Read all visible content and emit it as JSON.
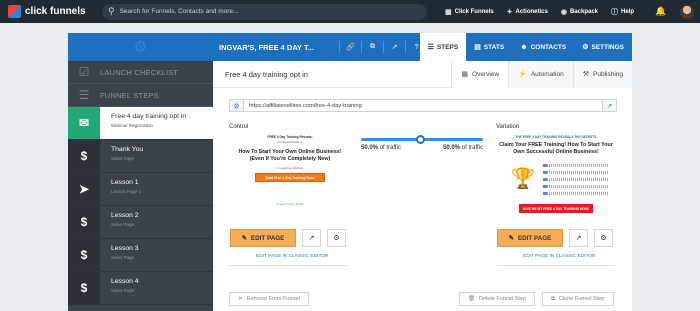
{
  "topbar": {
    "logo_text": "click funnels",
    "search_placeholder": "Search for Funnels, Contacts and more...",
    "nav": [
      {
        "label": "Click Funnels",
        "icon": "clickfunnels-icon"
      },
      {
        "label": "Actionetics",
        "icon": "actionetics-icon"
      },
      {
        "label": "Backpack",
        "icon": "backpack-icon"
      },
      {
        "label": "Help",
        "icon": "help-icon"
      }
    ]
  },
  "header": {
    "funnel_title": "INGVAR'S, FREE 4 DAY T...",
    "tabs": [
      {
        "label": "STEPS",
        "active": true
      },
      {
        "label": "STATS",
        "active": false
      },
      {
        "label": "CONTACTS",
        "active": false
      },
      {
        "label": "SETTINGS",
        "active": false
      }
    ]
  },
  "sidebar": {
    "nav": [
      {
        "label": "LAUNCH CHECKLIST"
      },
      {
        "label": "FUNNEL STEPS"
      }
    ],
    "steps": [
      {
        "name": "Free 4 day training opt in",
        "sub": "Webinar Registration",
        "icon": "email-icon",
        "active": true
      },
      {
        "name": "Thank You",
        "sub": "Sales Page",
        "icon": "dollar-icon",
        "active": false
      },
      {
        "name": "Lesson 1",
        "sub": "Launch Page 1",
        "icon": "rocket-icon",
        "active": false
      },
      {
        "name": "Lesson 2",
        "sub": "Sales Page",
        "icon": "dollar-icon",
        "active": false
      },
      {
        "name": "Lesson 3",
        "sub": "Sales Page",
        "icon": "dollar-icon",
        "active": false
      },
      {
        "name": "Lesson 4",
        "sub": "Sales Page",
        "icon": "dollar-icon",
        "active": false
      }
    ]
  },
  "main": {
    "step_title": "Free 4 day training opt in",
    "subtabs": [
      {
        "label": "Overview",
        "active": true
      },
      {
        "label": "Automation",
        "active": false
      },
      {
        "label": "Publishing",
        "active": false
      }
    ],
    "url": "https://affiliatesellites.com/free-4-day-training",
    "control": {
      "label": "Control",
      "preview_top": "FREE 4 Day Training Reveals:",
      "preview_sub": "Get Started NOW ►",
      "preview_heading": "How To Start Your Own Online Business! (Even If You're Completely New)",
      "preview_note": "1 Lead Free Webinar",
      "preview_cta": "Start Free 4 Day Training Now!",
      "preview_foot": "Privacy Policy | Terms"
    },
    "variation": {
      "label": "Variation",
      "preview_top": "THE FREE 4 DAY TRAINING REVEALS THE SECRETS",
      "preview_heading": "Claim Your FREE Training! How To Start Your Own Successful Online Business!",
      "preview_cta": "GIVE ME MY FREE 4 DAY TRAINING NOW!"
    },
    "split": {
      "left": "50.0%",
      "right": "50.0%",
      "suffix": "of traffic",
      "value": 0.5
    },
    "edit_label": "EDIT PAGE",
    "classic_label": "EDIT PAGE IN CLASSIC EDITOR",
    "footer": {
      "remove": "Remove From Funnel",
      "delete": "Delete Funnel Step",
      "clone": "Clone Funnel Step"
    }
  },
  "colors": {
    "primary": "#1e6fbd",
    "sidebar": "#3b4248",
    "active_step": "#22a876",
    "edit_button": "#f6ad58"
  }
}
